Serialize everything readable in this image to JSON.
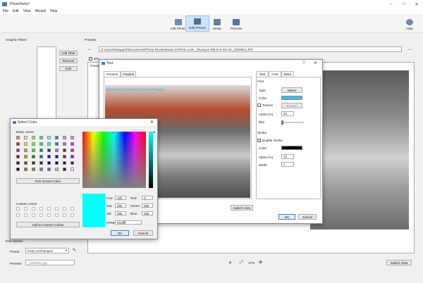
{
  "app": {
    "title": "PhotoMarks*",
    "menu": [
      "File",
      "Edit",
      "View",
      "Wizard",
      "Help"
    ]
  },
  "toolbar": {
    "add_photos": "Add Photos",
    "edit_photos": "Edit Photos",
    "setup": "Setup",
    "process": "Process",
    "help": "Help"
  },
  "left_panel": {
    "filters_label": "Graphic Filters",
    "add_filter": "Add Filter",
    "remove": "Remove",
    "edit": "Edit",
    "edit_names_label": "Edit Names",
    "preset_label": "Preset",
    "preset_value": "Keep Unchanged",
    "preview_label": "Preview",
    "preview_value": "_2050054.jpg"
  },
  "preview_panel": {
    "label": "Preview",
    "path": "D:\\Users\\Margaret\\Documents\\Photo Review\\Issue 84\\First Look _Olympus OM-D E-M1 III\\_2050054.JPG",
    "show_label": "Sho",
    "preview_tab": "Previe",
    "zoom": "17%",
    "switch_view": "Switch View"
  },
  "text_dialog": {
    "title": "Text",
    "tabs_left": [
      "Preview",
      "Original"
    ],
    "tabs_right": [
      "Text",
      "Font",
      "More"
    ],
    "selected_right_tab": "Font",
    "watermark_text": "Beautiful Gardens Garden Parade",
    "font_section": "Font",
    "type_label": "Type",
    "select_button": "Select",
    "color_label": "Color",
    "texture_label": "Texture",
    "browse_button": "Browse",
    "alpha_label": "Alpha (%)",
    "alpha_value": "20",
    "blur_label": "Blur",
    "stroke_section": "Stroke",
    "enable_stroke_label": "Enable Stroke",
    "stroke_color_label": "Color",
    "stroke_alpha_label": "Alpha (%)",
    "stroke_alpha_value": "10",
    "width_label": "Width",
    "width_value": "1",
    "switch_view": "Switch View",
    "ok": "OK",
    "cancel": "Cancel",
    "font_color": "#33c3e8",
    "stroke_color": "#000000"
  },
  "color_dialog": {
    "title": "Select Color",
    "basic_colors_label": "Basic colors",
    "pick_screen_color": "Pick Screen Color",
    "custom_colors_label": "Custom colors",
    "add_to_custom": "Add to Custom Colors",
    "hue_label": "Hue:",
    "hue_value": "180",
    "sat_label": "Sat:",
    "sat_value": "255",
    "val_label": "Val:",
    "val_value": "255",
    "red_label": "Red:",
    "red_value": "0",
    "green_label": "Green:",
    "green_value": "255",
    "blue_label": "Blue:",
    "blue_value": "255",
    "html_label": "HTML:",
    "html_value": "#00ffff",
    "ok": "OK",
    "cancel": "Cancel",
    "current_color": "#00ffff",
    "basic_colors": [
      "#ff8080",
      "#ffff80",
      "#80ff80",
      "#00ff80",
      "#80ffff",
      "#0080ff",
      "#ff80c0",
      "#ff80ff",
      "#ff0000",
      "#ffff00",
      "#80ff00",
      "#00ff40",
      "#00ffff",
      "#0080c0",
      "#8080c0",
      "#ff00ff",
      "#804040",
      "#ff8040",
      "#00ff00",
      "#008080",
      "#004080",
      "#8080ff",
      "#800040",
      "#ff0080",
      "#800000",
      "#ff8000",
      "#008000",
      "#008040",
      "#0000ff",
      "#0000a0",
      "#800080",
      "#8000ff",
      "#400000",
      "#804000",
      "#004000",
      "#004040",
      "#000080",
      "#000040",
      "#400040",
      "#400080",
      "#000000",
      "#808000",
      "#808040",
      "#808080",
      "#408080",
      "#c0c0c0",
      "#400040",
      "#ffffff"
    ]
  }
}
